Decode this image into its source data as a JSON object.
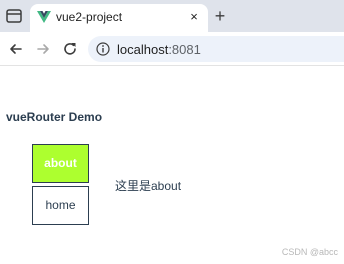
{
  "browser": {
    "tab": {
      "title": "vue2-project",
      "close_icon": "×"
    },
    "new_tab_icon": "+",
    "address": {
      "host": "localhost",
      "port": ":8081"
    }
  },
  "page": {
    "heading": "vueRouter Demo",
    "links": [
      {
        "label": "about",
        "active": true
      },
      {
        "label": "home",
        "active": false
      }
    ],
    "router_view_text": "这里是about",
    "active_color": "#adff2f"
  },
  "watermark": "CSDN @abcc"
}
